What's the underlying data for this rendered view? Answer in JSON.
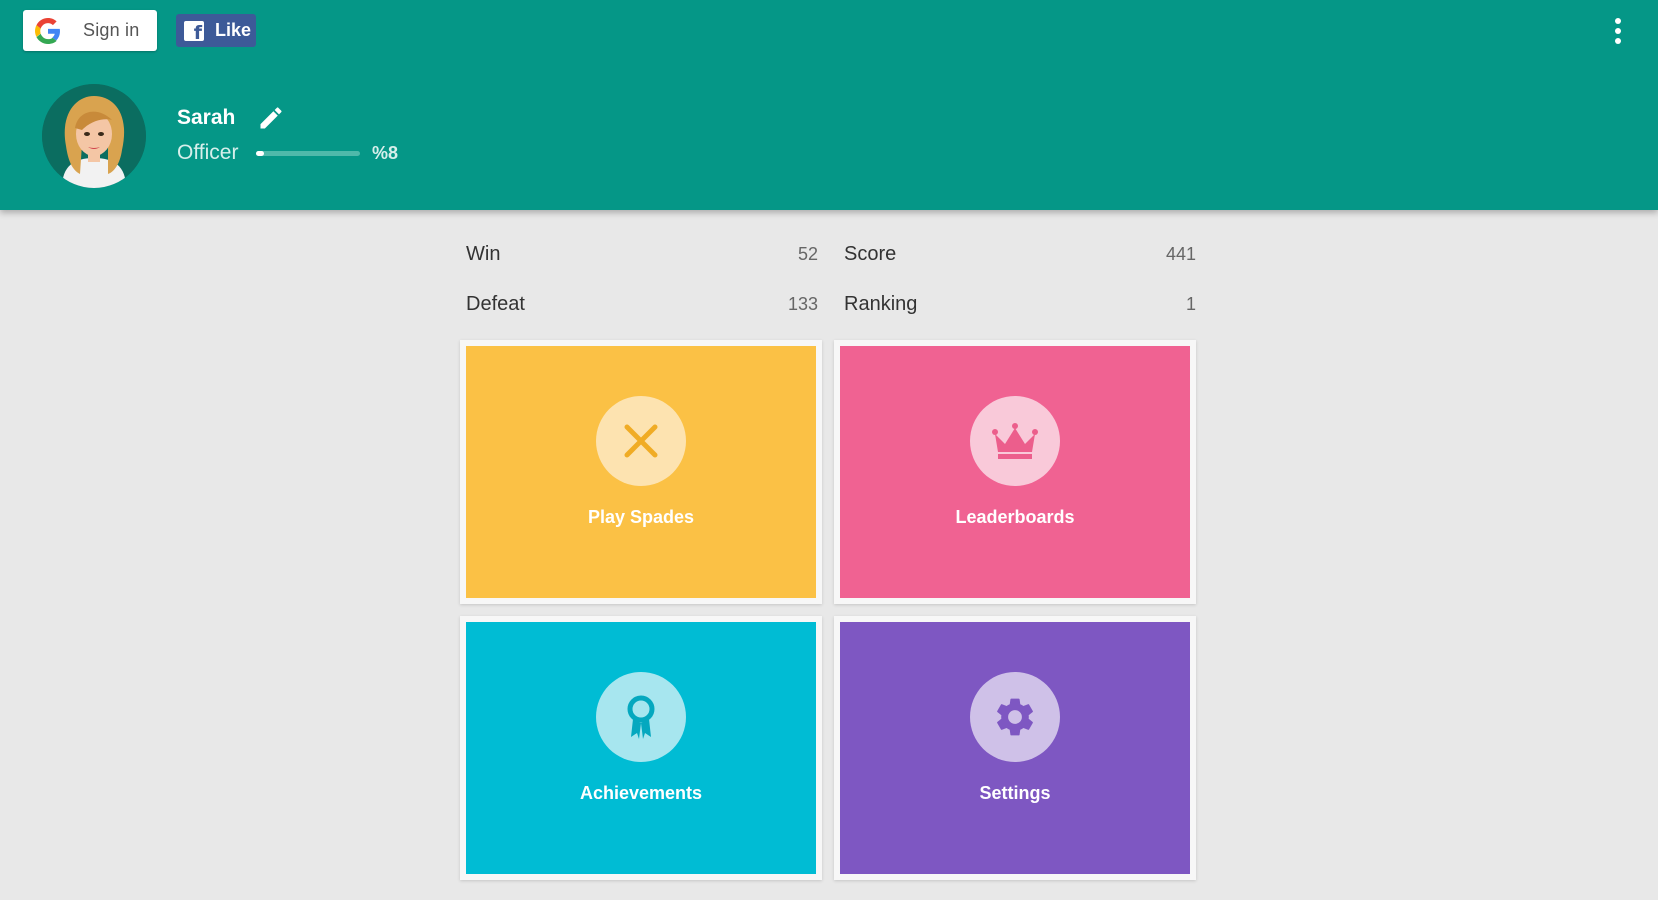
{
  "header": {
    "google_signin_label": "Sign in",
    "facebook_like_label": "Like",
    "more_menu_icon": "more-vert-icon",
    "color": "#059787"
  },
  "profile": {
    "name": "Sarah",
    "rank": "Officer",
    "progress_text": "%8",
    "progress_fraction": 0.08
  },
  "stats": {
    "win_label": "Win",
    "win_value": "52",
    "defeat_label": "Defeat",
    "defeat_value": "133",
    "score_label": "Score",
    "score_value": "441",
    "ranking_label": "Ranking",
    "ranking_value": "1"
  },
  "tiles": [
    {
      "label": "Play Spades",
      "icon": "crossed-swords-icon",
      "color": "#fbc145",
      "circle": "#fde3b0"
    },
    {
      "label": "Leaderboards",
      "icon": "crown-icon",
      "color": "#f06292",
      "circle": "#f9c9d9"
    },
    {
      "label": "Achievements",
      "icon": "award-ribbon-icon",
      "color": "#00bcd4",
      "circle": "#a7e6ef"
    },
    {
      "label": "Settings",
      "icon": "gear-icon",
      "color": "#7e57c2",
      "circle": "#cfc1e8"
    }
  ]
}
